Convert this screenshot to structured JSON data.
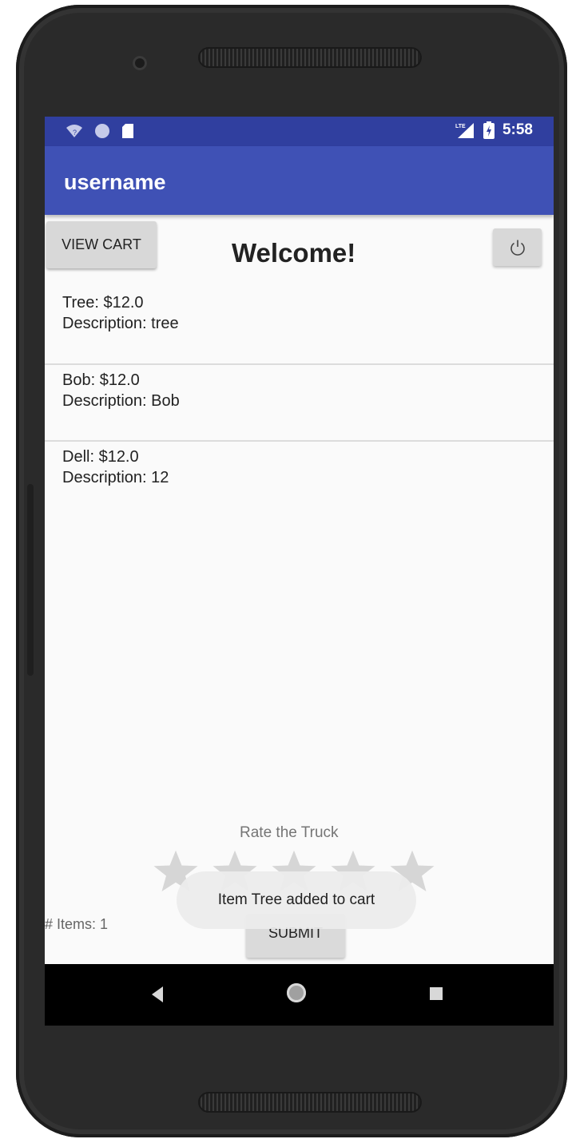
{
  "app": {
    "title": "username"
  },
  "status_bar": {
    "time": "5:58",
    "left_icons": [
      "wifi-icon",
      "circle-icon",
      "sd-card-icon"
    ],
    "right_icons": [
      "signal-icon",
      "battery-icon"
    ]
  },
  "header": {
    "view_cart_label": "VIEW CART",
    "welcome": "Welcome!",
    "power_icon": "power-icon"
  },
  "items": [
    {
      "line1": "Tree: $12.0",
      "line2": "Description: tree"
    },
    {
      "line1": "Bob: $12.0",
      "line2": "Description: Bob"
    },
    {
      "line1": "Dell: $12.0",
      "line2": "Description: 12"
    }
  ],
  "rating": {
    "label": "Rate the Truck",
    "stars_total": 5,
    "stars_filled": 0
  },
  "footer": {
    "count": "# Items: 1",
    "submit_label": "SUBMIT"
  },
  "toast": "Item Tree added to cart",
  "colors": {
    "status_bar": "#303f9f",
    "app_bar": "#3f51b5",
    "background": "#fafafa"
  }
}
